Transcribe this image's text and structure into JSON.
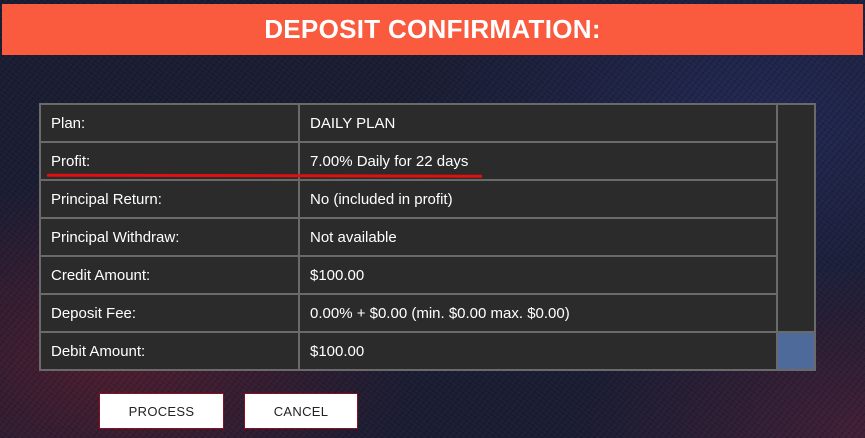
{
  "header": {
    "title": "DEPOSIT CONFIRMATION:"
  },
  "details": {
    "rows": [
      {
        "label": "Plan:",
        "value": "DAILY PLAN"
      },
      {
        "label": "Profit:",
        "value": "7.00% Daily for 22 days"
      },
      {
        "label": "Principal Return:",
        "value": "No (included in profit)"
      },
      {
        "label": "Principal Withdraw:",
        "value": "Not available"
      },
      {
        "label": "Credit Amount:",
        "value": "$100.00"
      },
      {
        "label": "Deposit Fee:",
        "value": "0.00% + $0.00 (min. $0.00 max. $0.00)"
      },
      {
        "label": "Debit Amount:",
        "value": "$100.00"
      }
    ]
  },
  "actions": {
    "process_label": "PROCESS",
    "cancel_label": "CANCEL"
  },
  "colors": {
    "banner": "#fa5a3e",
    "table_cell": "#2b2b2b",
    "table_border": "#6a6a6a",
    "highlight_underline": "#e01010",
    "scroll_accent": "#4e6a9a",
    "button_border": "#8a1020"
  }
}
